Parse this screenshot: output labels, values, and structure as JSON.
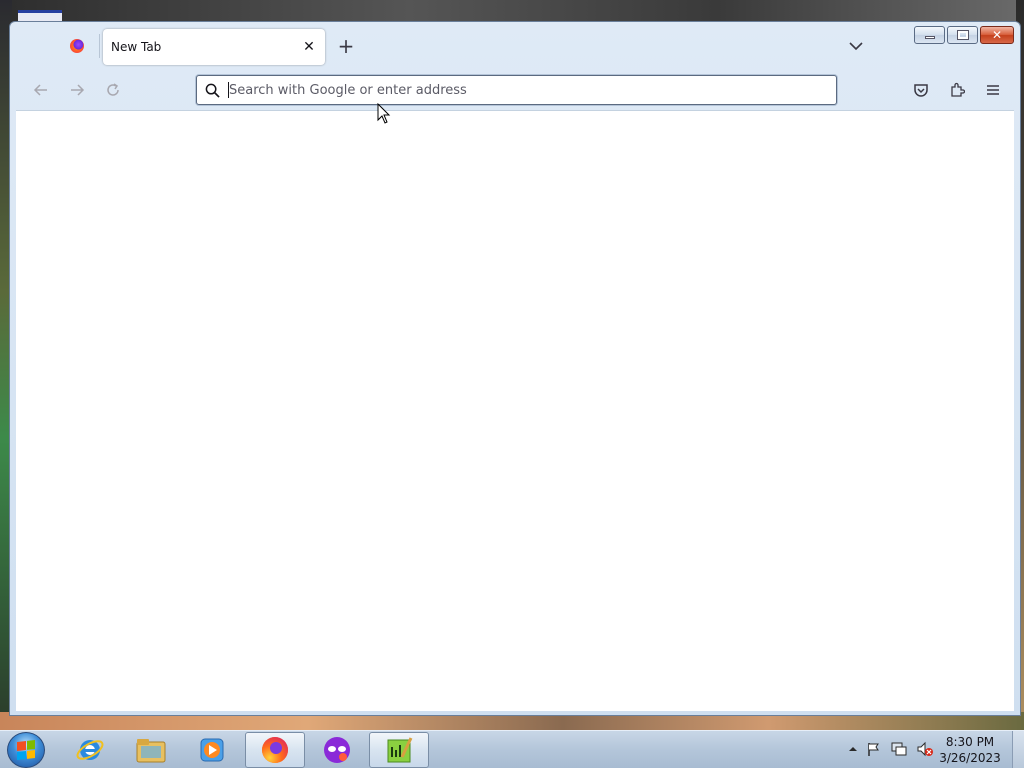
{
  "browser": {
    "tabs": [
      {
        "title": "New Tab",
        "active": true
      }
    ],
    "urlbar": {
      "placeholder": "Search with Google or enter address",
      "value": ""
    }
  },
  "taskbar": {
    "apps": [
      {
        "name": "Internet Explorer",
        "icon": "ie-icon"
      },
      {
        "name": "Windows Explorer",
        "icon": "folder-icon"
      },
      {
        "name": "Media Player",
        "icon": "media-player-icon"
      },
      {
        "name": "Firefox",
        "icon": "firefox-icon",
        "active": true
      },
      {
        "name": "Privacy app",
        "icon": "mask-icon"
      },
      {
        "name": "Editor",
        "icon": "notepad-chart-icon",
        "active": true
      }
    ],
    "clock": {
      "time": "8:30 PM",
      "date": "3/26/2023"
    }
  },
  "colors": {
    "accent": "#0060df",
    "content_bg": "#ffffff",
    "close_button": "#c4401c"
  }
}
